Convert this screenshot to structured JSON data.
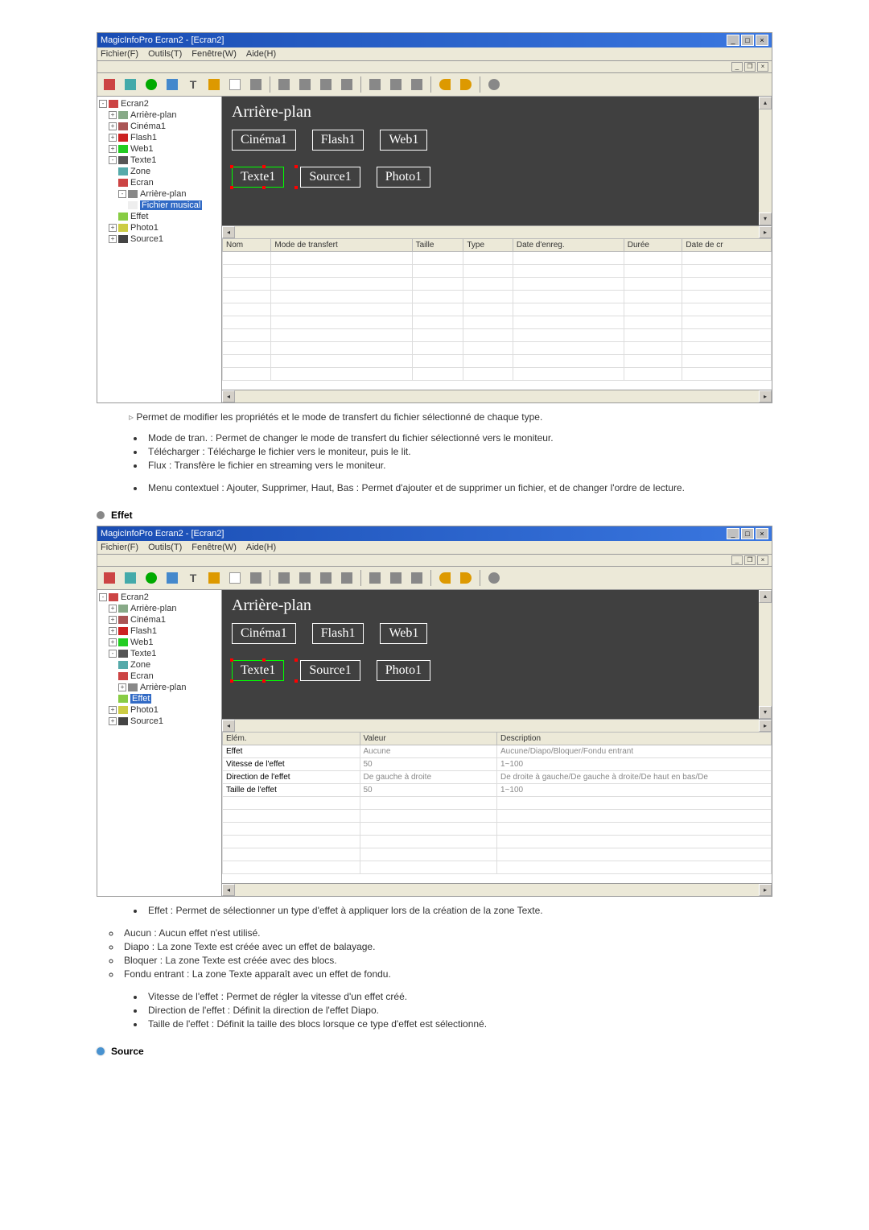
{
  "screenshot1": {
    "title": "MagicInfoPro Ecran2 - [Ecran2]",
    "menubar": [
      "Fichier(F)",
      "Outils(T)",
      "Fenêtre(W)",
      "Aide(H)"
    ],
    "tree": {
      "root": "Ecran2",
      "items": [
        "Arrière-plan",
        "Cinéma1",
        "Flash1",
        "Web1",
        "Texte1",
        "Zone",
        "Ecran",
        "Arrière-plan",
        "Fichier musical",
        "Effet",
        "Photo1",
        "Source1"
      ]
    },
    "canvas": {
      "title": "Arrière-plan",
      "row1": [
        "Cinéma1",
        "Flash1",
        "Web1"
      ],
      "row2": [
        "Texte1",
        "Source1",
        "Photo1"
      ]
    },
    "table": {
      "cols": [
        "Nom",
        "Mode de transfert",
        "Taille",
        "Type",
        "Date d'enreg.",
        "Durée",
        "Date de cr"
      ]
    }
  },
  "desc1": "Permet de modifier les propriétés et le mode de transfert du fichier sélectionné de chaque type.",
  "bullets1": [
    "Mode de tran. : Permet de changer le mode de transfert du fichier sélectionné vers le moniteur.",
    "Télécharger : Télécharge le fichier vers le moniteur, puis le lit.",
    "Flux : Transfère le fichier en streaming vers le moniteur."
  ],
  "bullets1b": [
    "Menu contextuel : Ajouter, Supprimer, Haut, Bas : Permet d'ajouter et de supprimer un fichier, et de changer l'ordre de lecture."
  ],
  "section_effet": "Effet",
  "screenshot2": {
    "title": "MagicInfoPro Ecran2 - [Ecran2]",
    "menubar": [
      "Fichier(F)",
      "Outils(T)",
      "Fenêtre(W)",
      "Aide(H)"
    ],
    "tree": {
      "root": "Ecran2",
      "items": [
        "Arrière-plan",
        "Cinéma1",
        "Flash1",
        "Web1",
        "Texte1",
        "Zone",
        "Ecran",
        "Arrière-plan",
        "Effet",
        "Photo1",
        "Source1"
      ]
    },
    "canvas": {
      "title": "Arrière-plan",
      "row1": [
        "Cinéma1",
        "Flash1",
        "Web1"
      ],
      "row2": [
        "Texte1",
        "Source1",
        "Photo1"
      ]
    },
    "table": {
      "cols": [
        "Elém.",
        "Valeur",
        "Description"
      ],
      "rows": [
        {
          "elem": "Effet",
          "val": "Aucune",
          "desc": "Aucune/Diapo/Bloquer/Fondu entrant"
        },
        {
          "elem": "Vitesse de l'effet",
          "val": "50",
          "desc": "1~100"
        },
        {
          "elem": "Direction de l'effet",
          "val": "De gauche à droite",
          "desc": "De droite à gauche/De gauche à droite/De haut en bas/De"
        },
        {
          "elem": "Taille de l'effet",
          "val": "50",
          "desc": "1~100"
        }
      ]
    }
  },
  "bullets2": [
    "Effet : Permet de sélectionner un type d'effet à appliquer lors de la création de la zone Texte."
  ],
  "subbullets2": [
    "Aucun : Aucun effet n'est utilisé.",
    "Diapo : La zone Texte est créée avec un effet de balayage.",
    "Bloquer : La zone Texte est créée avec des blocs.",
    "Fondu entrant : La zone Texte apparaît avec un effet de fondu."
  ],
  "bullets2b": [
    "Vitesse de l'effet : Permet de régler la vitesse d'un effet créé.",
    "Direction de l'effet : Définit la direction de l'effet Diapo.",
    "Taille de l'effet : Définit la taille des blocs lorsque ce type d'effet est sélectionné."
  ],
  "section_source": "Source"
}
